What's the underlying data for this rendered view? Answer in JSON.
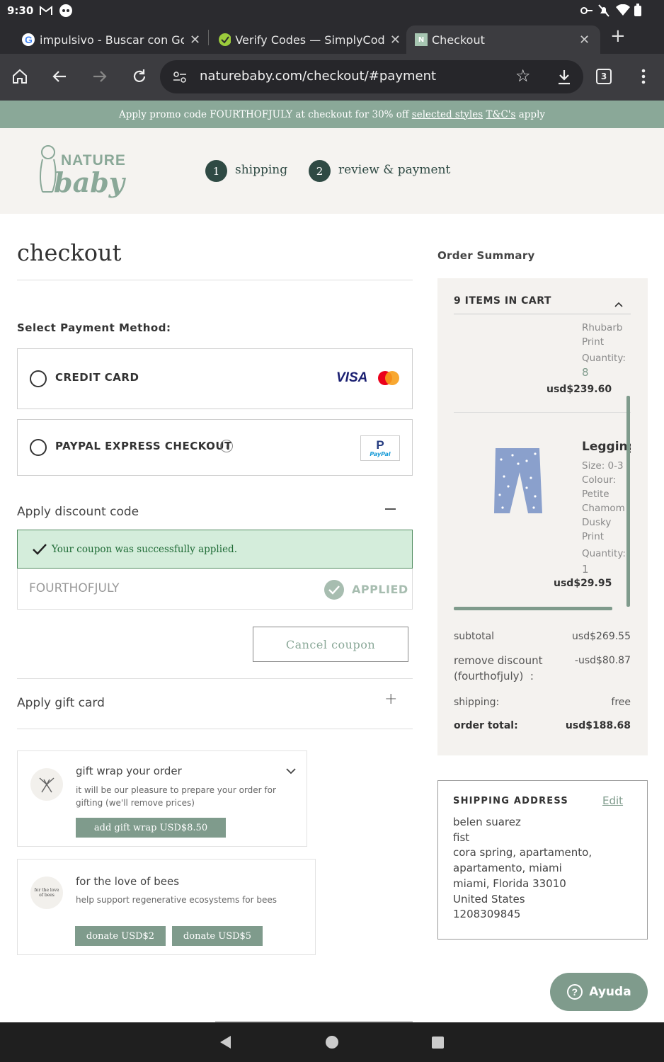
{
  "status": {
    "time": "9:30"
  },
  "tabs": [
    {
      "title": "impulsivo - Buscar con Goog"
    },
    {
      "title": "Verify Codes — SimplyCodes"
    },
    {
      "title": "Checkout"
    }
  ],
  "toolbar": {
    "url": "naturebaby.com/checkout/#payment",
    "tab_count": "3"
  },
  "promo": {
    "text": "Apply promo code FOURTHOFJULY at checkout for 30% off ",
    "link1": "selected styles",
    "link2": "T&C's",
    "suffix": " apply"
  },
  "header": {
    "logo_line1": "NATURE",
    "logo_line2": "baby",
    "steps": [
      {
        "num": "1",
        "label": "shipping"
      },
      {
        "num": "2",
        "label": "review & payment"
      }
    ]
  },
  "main": {
    "title": "checkout",
    "payment_label": "Select Payment Method:",
    "credit_card": "CREDIT CARD",
    "visa": "VISA",
    "paypal": "PAYPAL EXPRESS CHECKOUT",
    "paypal_logo": "PayPal",
    "discount_title": "Apply discount code",
    "coupon_success": "Your coupon was successfully applied.",
    "coupon_code": "FOURTHOFJULY",
    "applied": "APPLIED",
    "cancel_coupon": "Cancel coupon",
    "gift_card_title": "Apply gift card",
    "gift_wrap_title": "gift wrap your order",
    "gift_wrap_desc": "it will be our pleasure to prepare your order for gifting (we'll remove prices)",
    "gift_wrap_button": "add gift wrap USD$8.50",
    "bees_title": "for the love of bees",
    "bees_desc": "help support regenerative ecosystems for bees",
    "bees_logo": "for the love of bees",
    "donate2": "donate USD$2",
    "donate5": "donate USD$5"
  },
  "summary": {
    "title": "Order Summary",
    "cart_header": "9 ITEMS IN CART",
    "item1": {
      "lines": [
        "Rhubarb",
        "Print"
      ],
      "qty_label": "Quantity:",
      "qty": "8",
      "price": "usd$239.60"
    },
    "item2": {
      "name": "Legging",
      "lines": [
        "Size: 0-3",
        "Colour:",
        "Petite",
        "Chamom",
        "Dusky",
        "Print"
      ],
      "qty_label": "Quantity:",
      "qty": "1",
      "price": "usd$29.95"
    },
    "subtotal_label": "subtotal",
    "subtotal": "usd$269.55",
    "discount_label1": "remove discount",
    "discount_label2": "(fourthofjuly)  :",
    "discount": "-usd$80.87",
    "shipping_label": "shipping:",
    "shipping": "free",
    "total_label": "order total:",
    "total": "usd$188.68"
  },
  "shipping_address": {
    "title": "SHIPPING ADDRESS",
    "edit": "Edit",
    "lines": [
      "belen suarez",
      "fist",
      "cora spring, apartamento,",
      "apartamento, miami",
      "miami, Florida 33010",
      "United States",
      "1208309845"
    ]
  },
  "help": {
    "label": "Ayuda"
  },
  "colors": {
    "accent": "#7f9b8c",
    "dark_green": "#2f4a44",
    "promo_bg": "#8aa898",
    "success_bg": "#d4eddb"
  }
}
